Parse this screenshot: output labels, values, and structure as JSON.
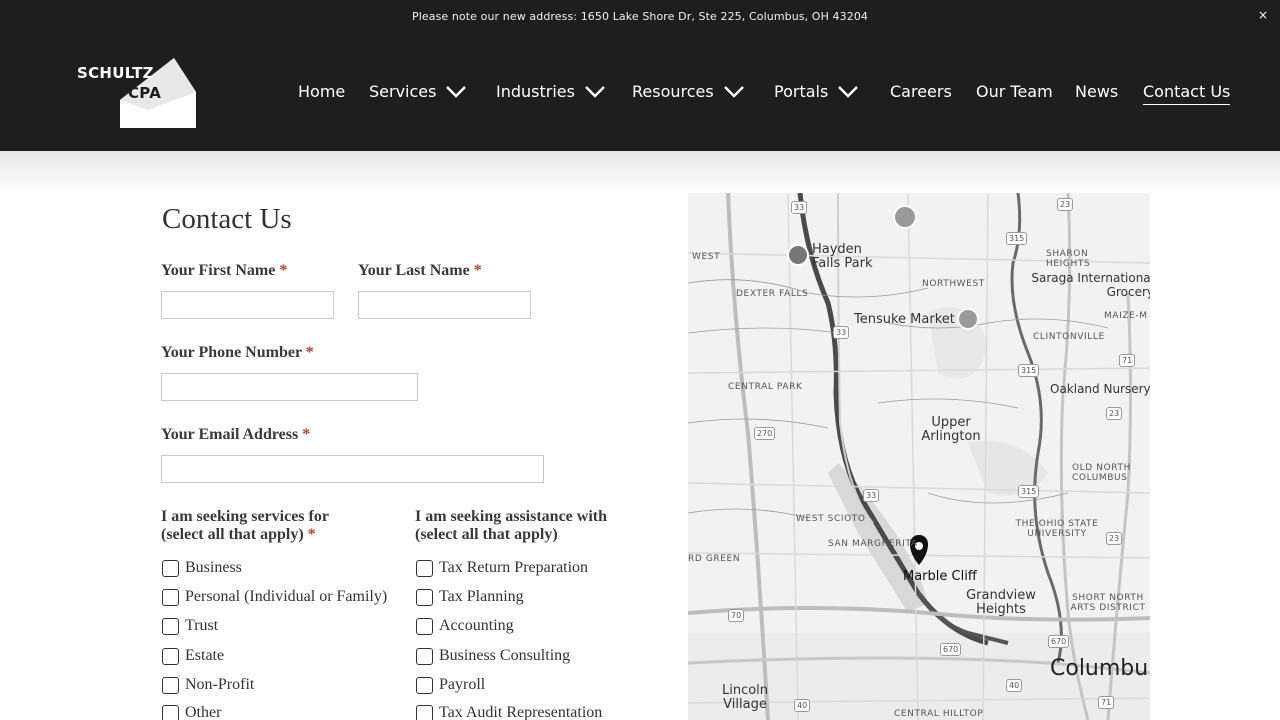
{
  "announcement": {
    "text": "Please note our new address: 1650 Lake Shore Dr, Ste 225, Columbus, OH 43204",
    "close": "×"
  },
  "logo": {
    "line1": "SCHULTZ",
    "line2": "CPA"
  },
  "nav": [
    {
      "label": "Home"
    },
    {
      "label": "Services",
      "dropdown": true
    },
    {
      "label": "Industries",
      "dropdown": true
    },
    {
      "label": "Resources",
      "dropdown": true
    },
    {
      "label": "Portals",
      "dropdown": true
    },
    {
      "label": "Careers"
    },
    {
      "label": "Our Team"
    },
    {
      "label": "News"
    },
    {
      "label": "Contact Us",
      "active": true
    }
  ],
  "form": {
    "title": "Contact Us",
    "required_mark": "*",
    "first_name_label": "Your First Name",
    "last_name_label": "Your Last Name",
    "phone_label": "Your Phone Number",
    "email_label": "Your Email Address",
    "first_name_value": "",
    "last_name_value": "",
    "phone_value": "",
    "email_value": "",
    "services_label_1": "I am seeking services for",
    "services_label_2": "(select all that apply)",
    "assist_label_1": "I am seeking assistance with",
    "assist_label_2": "(select all that apply)",
    "services_options": [
      "Business",
      "Personal (Individual or Family)",
      "Trust",
      "Estate",
      "Non-Profit",
      "Other"
    ],
    "assist_options": [
      "Tax Return Preparation",
      "Tax Planning",
      "Accounting",
      "Business Consulting",
      "Payroll",
      "Tax Audit Representation"
    ]
  },
  "map": {
    "labels": {
      "hayden_falls_park": "Hayden Falls Park",
      "west": "WEST",
      "dexter_falls": "DEXTER FALLS",
      "northwest": "NORTHWEST",
      "sharon_heights": "SHARON HEIGHTS",
      "saraga": "Saraga International Grocery",
      "tensuke": "Tensuke Market",
      "maize": "MAIZE-M",
      "clintonville": "CLINTONVILLE",
      "central_park": "CENTRAL PARK",
      "oakland": "Oakland Nursery",
      "upper_arlington": "Upper Arlington",
      "old_north_columbus": "OLD NORTH COLUMBUS",
      "west_scioto": "WEST SCIOTO",
      "ohio_state": "THE OHIO STATE UNIVERSITY",
      "san_margherita": "SAN MARGHERITA",
      "rd_green": "RD GREEN",
      "marble_cliff": "Marble Cliff",
      "grandview_heights": "Grandview Heights",
      "short_north": "SHORT NORTH ARTS DISTRICT",
      "columbus": "Columbu",
      "lincoln_village": "Lincoln Village",
      "central_hilltop": "CENTRAL HILLTOP"
    },
    "shields": [
      "33",
      "23",
      "315",
      "33",
      "270",
      "315",
      "33",
      "315",
      "23",
      "71",
      "23",
      "70",
      "670",
      "670",
      "40",
      "40",
      "71"
    ]
  }
}
